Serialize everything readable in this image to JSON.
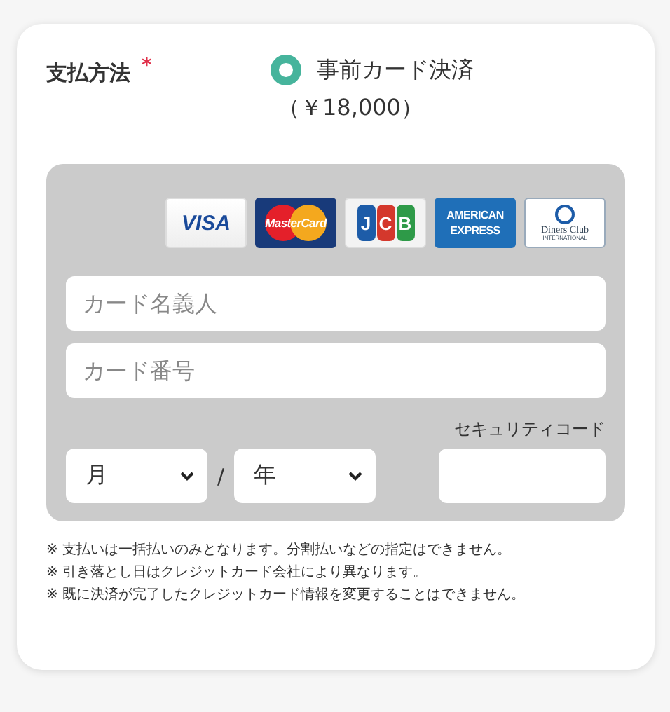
{
  "payment": {
    "label": "支払方法",
    "required_mark": "*",
    "options": [
      {
        "label": "事前カード決済",
        "price": "（￥18,000）",
        "selected": true
      }
    ]
  },
  "card_brands": [
    {
      "kind": "visa",
      "lines": [
        "VISA"
      ]
    },
    {
      "kind": "mastercard",
      "lines": [
        "MasterCard"
      ]
    },
    {
      "kind": "jcb",
      "lines": [
        "J",
        "C",
        "B"
      ]
    },
    {
      "kind": "amex",
      "lines": [
        "AMERICAN",
        "EXPRESS"
      ]
    },
    {
      "kind": "diners",
      "lines": [
        "Diners Club",
        "INTERNATIONAL"
      ]
    }
  ],
  "fields": {
    "holder": {
      "placeholder": "カード名義人"
    },
    "number": {
      "placeholder": "カード番号"
    },
    "month": {
      "placeholder": "月"
    },
    "separator": "/",
    "year": {
      "placeholder": "年"
    },
    "security": {
      "label": "セキュリティコード"
    }
  },
  "notes": [
    "※ 支払いは一括払いのみとなります。分割払いなどの指定はできません。",
    "※ 引き落とし日はクレジットカード会社により異なります。",
    "※ 既に決済が完了したクレジットカード情報を変更することはできません。"
  ]
}
